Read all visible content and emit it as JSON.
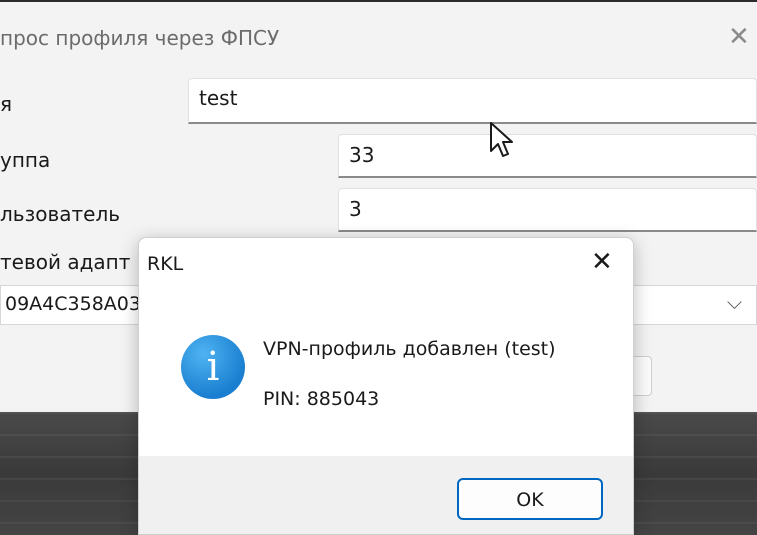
{
  "window": {
    "title": "прос профиля через ФПСУ",
    "close_glyph": "✕"
  },
  "form": {
    "fields": [
      {
        "label": "я",
        "value": "test"
      },
      {
        "label": "уппа",
        "value": "33"
      },
      {
        "label": "льзователь",
        "value": "3"
      }
    ],
    "adapter_label": "тевой адапт",
    "adapter_value": "09A4C358A03"
  },
  "dialog": {
    "title": "RKL",
    "close_glyph": "✕",
    "icon": "info-icon",
    "message": "VPN-профиль добавлен (test)",
    "pin": "PIN: 885043",
    "ok_label": "OK"
  },
  "colors": {
    "accent": "#0067c0",
    "info_icon": "#1a7fd0"
  }
}
